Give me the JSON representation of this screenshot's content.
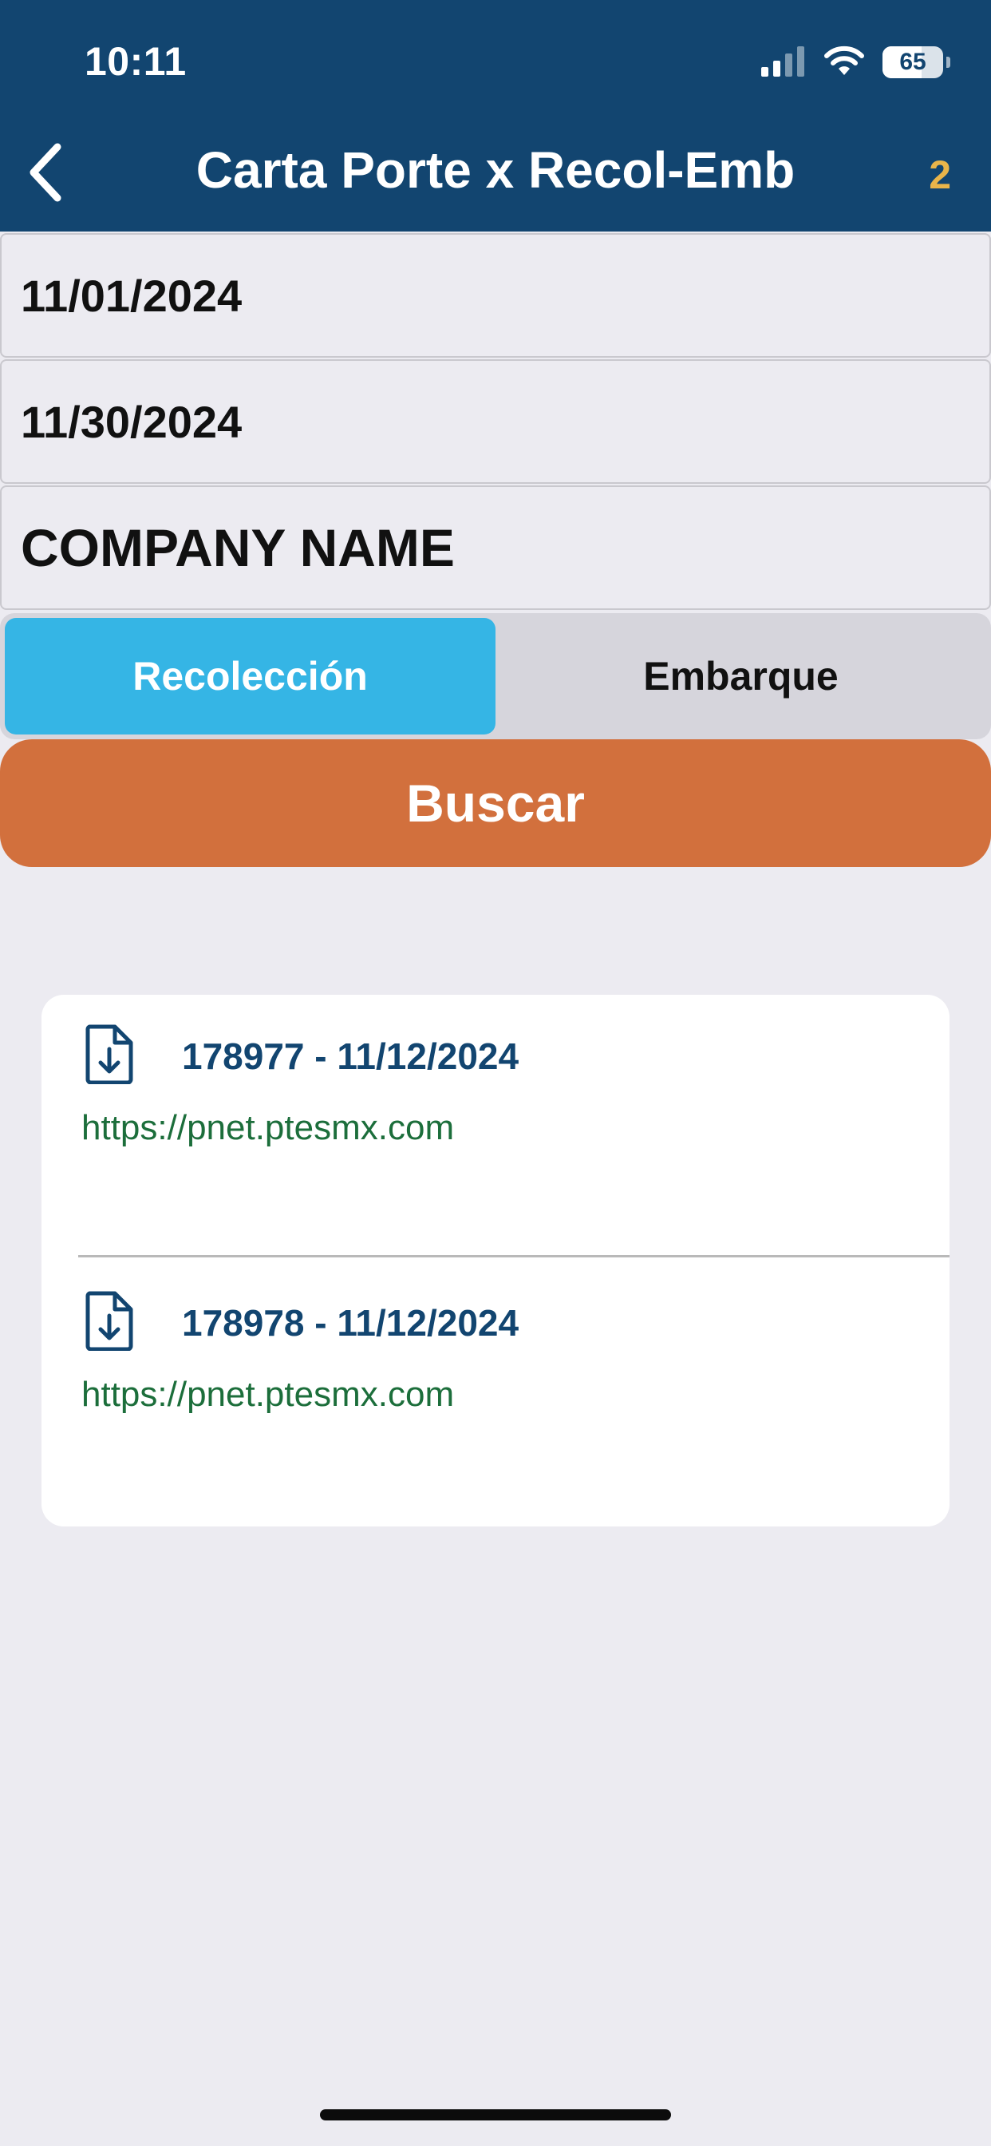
{
  "status_bar": {
    "time": "10:11",
    "battery": "65",
    "battery_level": 0.65,
    "signal_icon": "cellular-signal-icon",
    "wifi_icon": "wifi-icon"
  },
  "nav": {
    "back_icon": "chevron-left-icon",
    "title": "Carta Porte x Recol-Emb",
    "count": "2",
    "count_color": "#E9B54A"
  },
  "filters": {
    "start_date": "11/01/2024",
    "end_date": "11/30/2024",
    "company": "COMPANY NAME"
  },
  "segment": {
    "options": [
      "Recolección",
      "Embarque"
    ],
    "selected": "Recolección",
    "active_color": "#35B5E5"
  },
  "search_button": {
    "label": "Buscar",
    "color": "#D2703D"
  },
  "results": [
    {
      "title": "178977 - 11/12/2024",
      "link": "https://pnet.ptesmx.com",
      "icon": "file-download-icon"
    },
    {
      "title": "178978 - 11/12/2024",
      "link": "https://pnet.ptesmx.com",
      "icon": "file-download-icon"
    }
  ],
  "colors": {
    "header": "#124570",
    "background": "#ECEBF1",
    "link": "#1C6E3B"
  }
}
